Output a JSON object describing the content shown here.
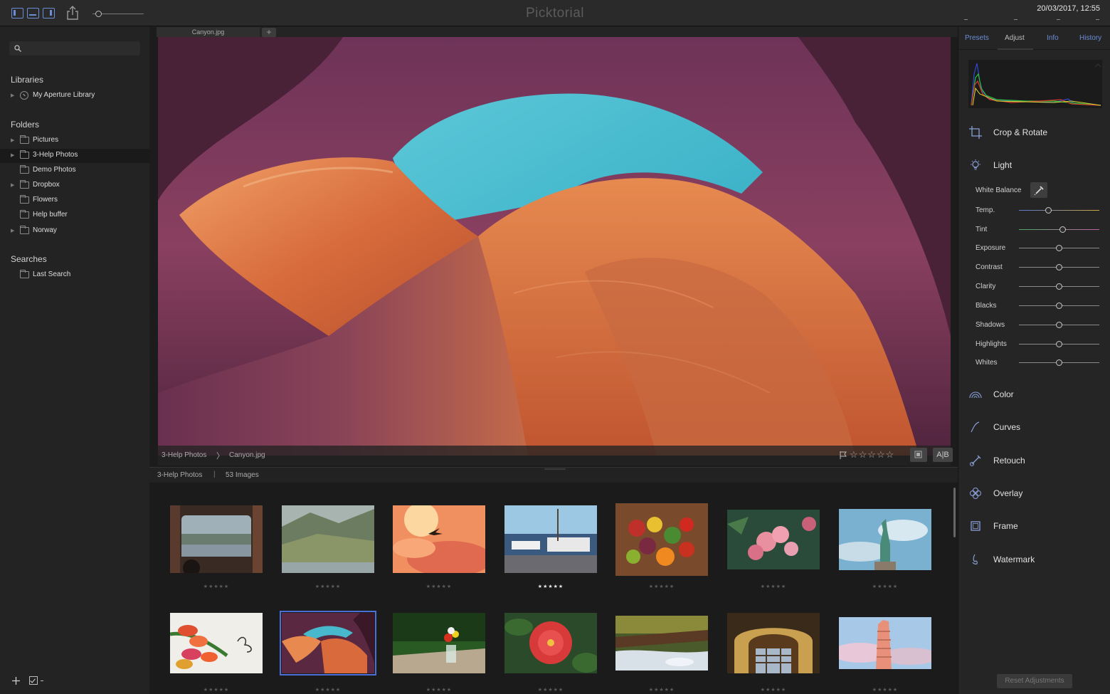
{
  "app": {
    "title": "Picktorial",
    "datetime": "20/03/2017, 12:55"
  },
  "sidebar": {
    "sections": {
      "libraries": "Libraries",
      "folders": "Folders",
      "searches": "Searches"
    },
    "library": "My Aperture Library",
    "folders": [
      "Pictures",
      "3-Help Photos",
      "Demo Photos",
      "Dropbox",
      "Flowers",
      "Help buffer",
      "Norway"
    ],
    "searches": [
      "Last Search"
    ],
    "selected_folder": "3-Help Photos"
  },
  "viewer": {
    "tab_label": "Canyon.jpg",
    "new_tab_symbol": "+",
    "breadcrumb": {
      "folder": "3-Help Photos",
      "separator": "〉",
      "file": "Canyon.jpg"
    },
    "rating_stars": "☆☆☆☆☆",
    "ab_label": "A|B"
  },
  "browser": {
    "folder": "3-Help Photos",
    "separator": "|",
    "count": "53 Images",
    "thumbnails": [
      {
        "name": "window-view",
        "stars": "★★★★★",
        "rated": false
      },
      {
        "name": "mountain-valley",
        "stars": "★★★★★",
        "rated": false
      },
      {
        "name": "bird-sunset",
        "stars": "★★★★★",
        "rated": false
      },
      {
        "name": "harbor-boats",
        "stars": "★★★★★",
        "rated": true
      },
      {
        "name": "fruits",
        "stars": "★★★★★",
        "rated": false
      },
      {
        "name": "pink-flowers",
        "stars": "★★★★★",
        "rated": false
      },
      {
        "name": "statue-of-liberty",
        "stars": "★★★★★",
        "rated": false
      },
      {
        "name": "tulips",
        "stars": "★★★★★",
        "rated": false
      },
      {
        "name": "canyon",
        "stars": "★★★★★",
        "rated": false
      },
      {
        "name": "flowers-table",
        "stars": "★★★★★",
        "rated": false
      },
      {
        "name": "red-hibiscus",
        "stars": "★★★★★",
        "rated": false
      },
      {
        "name": "stream-forest",
        "stars": "★★★★★",
        "rated": false
      },
      {
        "name": "dome-interior",
        "stars": "★★★★★",
        "rated": false
      },
      {
        "name": "leaning-tower",
        "stars": "★★★★★",
        "rated": false
      }
    ]
  },
  "panel": {
    "tabs": [
      "Presets",
      "Adjust",
      "Info",
      "History"
    ],
    "active_tab": "Adjust",
    "tools": {
      "crop": "Crop & Rotate",
      "light": "Light",
      "color": "Color",
      "curves": "Curves",
      "retouch": "Retouch",
      "overlay": "Overlay",
      "frame": "Frame",
      "watermark": "Watermark"
    },
    "white_balance": "White Balance",
    "adjustments": [
      {
        "label": "Temp.",
        "value": 0.37
      },
      {
        "label": "Tint",
        "value": 0.54
      },
      {
        "label": "Exposure",
        "value": 0.5
      },
      {
        "label": "Contrast",
        "value": 0.5
      },
      {
        "label": "Clarity",
        "value": 0.5
      },
      {
        "label": "Blacks",
        "value": 0.5
      },
      {
        "label": "Shadows",
        "value": 0.5
      },
      {
        "label": "Highlights",
        "value": 0.5
      },
      {
        "label": "Whites",
        "value": 0.5
      }
    ],
    "reset_label": "Reset Adjustments"
  },
  "colors": {
    "accent": "#6b8dd6",
    "selection": "#4a6fd6",
    "background": "#1e1e1e"
  }
}
